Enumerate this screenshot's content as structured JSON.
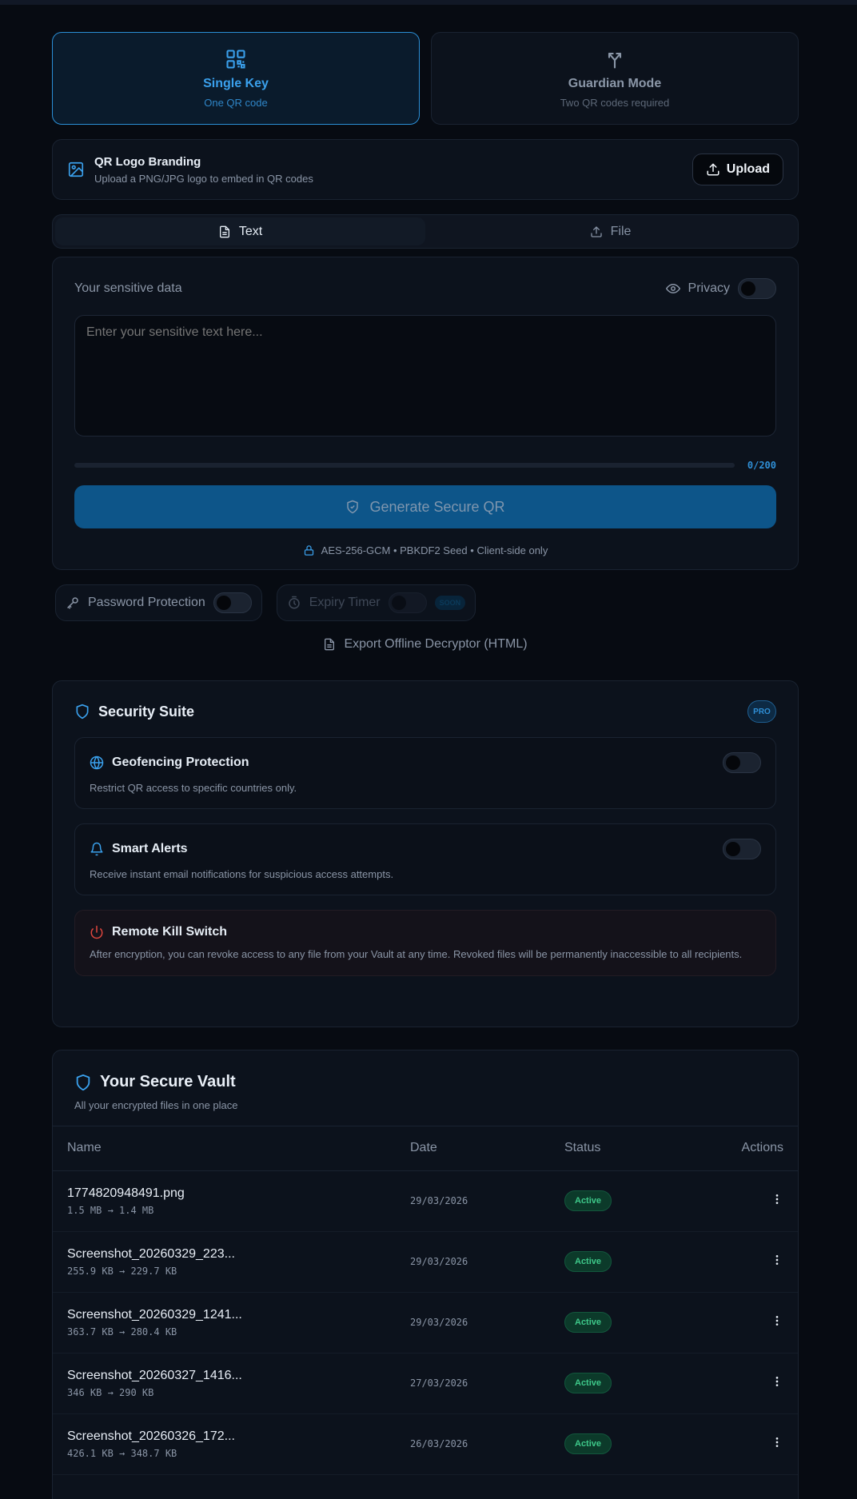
{
  "modes": [
    {
      "icon": "qr-code-icon",
      "title": "Single Key",
      "subtitle": "One QR code",
      "active": true
    },
    {
      "icon": "split-icon",
      "title": "Guardian Mode",
      "subtitle": "Two QR codes required",
      "active": false
    }
  ],
  "branding": {
    "title": "QR Logo Branding",
    "subtitle": "Upload a PNG/JPG logo to embed in QR codes",
    "upload_label": "Upload"
  },
  "tabs": [
    {
      "label": "Text",
      "active": true
    },
    {
      "label": "File",
      "active": false
    }
  ],
  "input": {
    "label": "Your sensitive data",
    "privacy_label": "Privacy",
    "placeholder": "Enter your sensitive text here...",
    "counter": "0/200",
    "progress": 0,
    "generate_label": "Generate Secure QR",
    "encryption_note": "AES-256-GCM • PBKDF2 Seed • Client-side only"
  },
  "options": {
    "password_label": "Password Protection",
    "expiry_label": "Expiry Timer",
    "soon_badge": "SOON"
  },
  "export_label": "Export Offline Decryptor (HTML)",
  "suite": {
    "title": "Security Suite",
    "badge": "PRO",
    "features": [
      {
        "title": "Geofencing Protection",
        "desc": "Restrict QR access to specific countries only."
      },
      {
        "title": "Smart Alerts",
        "desc": "Receive instant email notifications for suspicious access attempts."
      },
      {
        "title": "Remote Kill Switch",
        "desc": "After encryption, you can revoke access to any file from your Vault at any time. Revoked files will be permanently inaccessible to all recipients."
      }
    ]
  },
  "vault": {
    "title": "Your Secure Vault",
    "subtitle": "All your encrypted files in one place",
    "columns": [
      "Name",
      "Date",
      "Status",
      "Actions"
    ],
    "rows": [
      {
        "name": "1774820948491.png",
        "size": "1.5 MB → 1.4 MB",
        "date": "29/03/2026",
        "status": "Active"
      },
      {
        "name": "Screenshot_20260329_223...",
        "size": "255.9 KB → 229.7 KB",
        "date": "29/03/2026",
        "status": "Active"
      },
      {
        "name": "Screenshot_20260329_1241...",
        "size": "363.7 KB → 280.4 KB",
        "date": "29/03/2026",
        "status": "Active"
      },
      {
        "name": "Screenshot_20260327_1416...",
        "size": "346 KB → 290 KB",
        "date": "27/03/2026",
        "status": "Active"
      },
      {
        "name": "Screenshot_20260326_172...",
        "size": "426.1 KB → 348.7 KB",
        "date": "26/03/2026",
        "status": "Active"
      }
    ]
  },
  "colors": {
    "accent": "#2b8fd6",
    "background": "#070b12",
    "active_status": "#3ec98a",
    "danger": "#e0463e"
  }
}
